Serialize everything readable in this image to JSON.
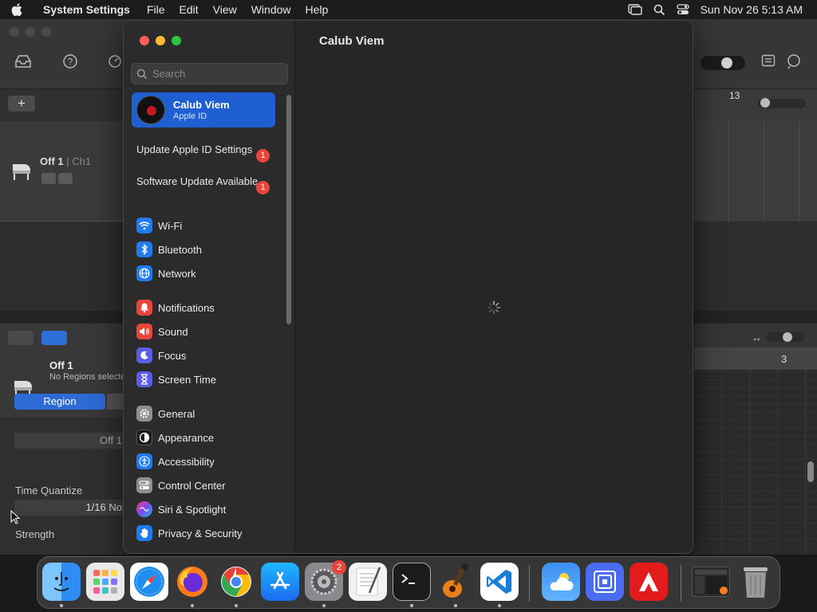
{
  "menubar": {
    "app_name": "System Settings",
    "menus": [
      "File",
      "Edit",
      "View",
      "Window",
      "Help"
    ],
    "clock": "Sun Nov 26  5:13 AM"
  },
  "garageband": {
    "track_name": "Off 1",
    "track_channel": "| Ch1",
    "ruler_bar": "13",
    "editor_title": "Off 1",
    "editor_subtitle": "No Regions selected",
    "region_tab": "Region",
    "name_field": "Off 1",
    "time_quantize_label": "Time Quantize",
    "time_quantize_value": "1/16 No",
    "strength_label": "Strength",
    "editor_ruler_bar": "3"
  },
  "settings": {
    "search_placeholder": "Search",
    "apple_id": {
      "name": "Calub Viem",
      "subtitle": "Apple ID"
    },
    "notices": [
      {
        "label": "Update Apple ID Settings",
        "badge": "1"
      },
      {
        "label": "Software Update Available",
        "badge": "1"
      }
    ],
    "group1": [
      {
        "label": "Wi-Fi",
        "icon": "wifi-icon",
        "color": "#1f7cf0"
      },
      {
        "label": "Bluetooth",
        "icon": "bluetooth-icon",
        "color": "#1f7cf0"
      },
      {
        "label": "Network",
        "icon": "globe-icon",
        "color": "#1f7cf0"
      }
    ],
    "group2": [
      {
        "label": "Notifications",
        "icon": "bell-icon",
        "color": "#e8453c"
      },
      {
        "label": "Sound",
        "icon": "speaker-icon",
        "color": "#e8453c"
      },
      {
        "label": "Focus",
        "icon": "moon-icon",
        "color": "#5e5ce6"
      },
      {
        "label": "Screen Time",
        "icon": "hourglass-icon",
        "color": "#5e5ce6"
      }
    ],
    "group3": [
      {
        "label": "General",
        "icon": "gear-icon",
        "color": "#8e8e93"
      },
      {
        "label": "Appearance",
        "icon": "appearance-icon",
        "color": "#1c1c1e"
      },
      {
        "label": "Accessibility",
        "icon": "accessibility-icon",
        "color": "#1f7cf0"
      },
      {
        "label": "Control Center",
        "icon": "control-center-icon",
        "color": "#8e8e93"
      },
      {
        "label": "Siri & Spotlight",
        "icon": "siri-icon",
        "color": "#b44be0"
      },
      {
        "label": "Privacy & Security",
        "icon": "hand-icon",
        "color": "#1f7cf0"
      }
    ],
    "content_title": "Calub Viem"
  },
  "dock": {
    "apps": [
      {
        "name": "finder-icon",
        "color": "#2f8cf2"
      },
      {
        "name": "launchpad-icon",
        "color": "#e8e8e8"
      },
      {
        "name": "safari-icon",
        "color": "#1e8ff0"
      },
      {
        "name": "firefox-icon",
        "color": "#ff7a1a"
      },
      {
        "name": "chrome-icon",
        "color": "#ffffff"
      },
      {
        "name": "app-store-icon",
        "color": "#1a8cf5"
      },
      {
        "name": "system-settings-icon",
        "color": "#8a8a8e"
      },
      {
        "name": "textedit-icon",
        "color": "#f2f2f2"
      },
      {
        "name": "terminal-icon",
        "color": "#1b1b1b"
      },
      {
        "name": "garageband-icon",
        "color": "#3a3a3a"
      },
      {
        "name": "vscode-icon",
        "color": "#ffffff"
      },
      {
        "name": "weather-icon",
        "color": "#3b8ff0"
      },
      {
        "name": "screen-sharing-icon",
        "color": "#4b6cf0"
      },
      {
        "name": "adobe-icon",
        "color": "#e41b1b"
      },
      {
        "name": "recent-window-icon",
        "color": "#2a2a2a"
      },
      {
        "name": "trash-icon",
        "color": "#9a9a9a"
      }
    ],
    "settings_badge": "2"
  }
}
